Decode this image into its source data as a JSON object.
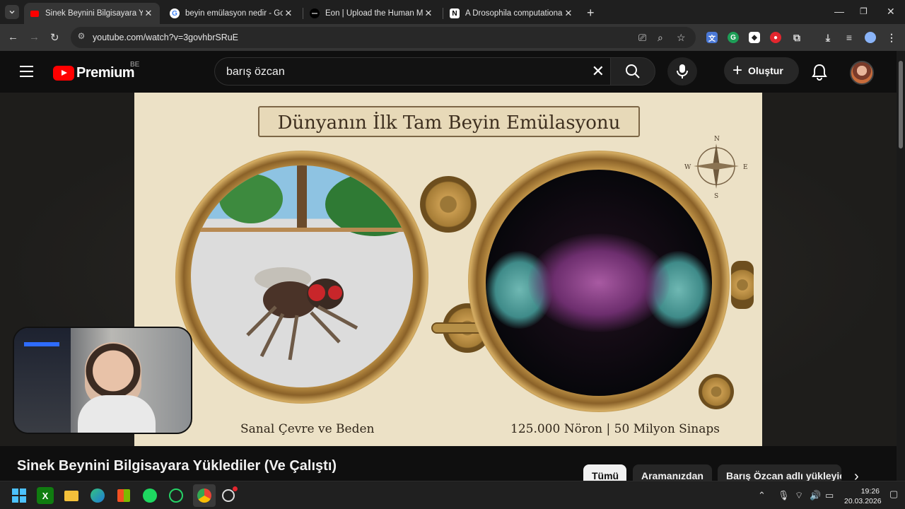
{
  "browser": {
    "tabs": [
      {
        "title": "Sinek Beynini Bilgisayara Yükled",
        "active": true,
        "favicon": "youtube-icon"
      },
      {
        "title": "beyin emülasyon nedir - Google",
        "active": false,
        "favicon": "google-icon"
      },
      {
        "title": "Eon | Upload the Human Mind",
        "active": false,
        "favicon": "eon-icon"
      },
      {
        "title": "A Drosophila computational bra",
        "active": false,
        "favicon": "notion-icon"
      }
    ],
    "url": "youtube.com/watch?v=3govhbrSRuE"
  },
  "youtube": {
    "brand": "Premium",
    "region": "BE",
    "search_query": "barış özcan",
    "create_label": "Oluştur",
    "video_title": "Sinek Beynini Bilgisayara Yüklediler (Ve Çalıştı)",
    "chips": [
      "Tümü",
      "Aramanızdan",
      "Barış Özcan adlı yükleyici"
    ]
  },
  "video_frame": {
    "title": "Dünyanın İlk Tam Beyin Emülasyonu",
    "caption_left": "Sanal Çevre ve Beden",
    "caption_right": "125.000 Nöron | 50 Milyon Sinaps",
    "compass": {
      "n": "N",
      "e": "E",
      "s": "S",
      "w": "W"
    }
  },
  "taskbar": {
    "time": "19:26",
    "date": "20.03.2026"
  },
  "colors": {
    "youtube_red": "#ff0000",
    "chip_active_bg": "#f1f1f1",
    "parchment": "#ece1c6"
  }
}
